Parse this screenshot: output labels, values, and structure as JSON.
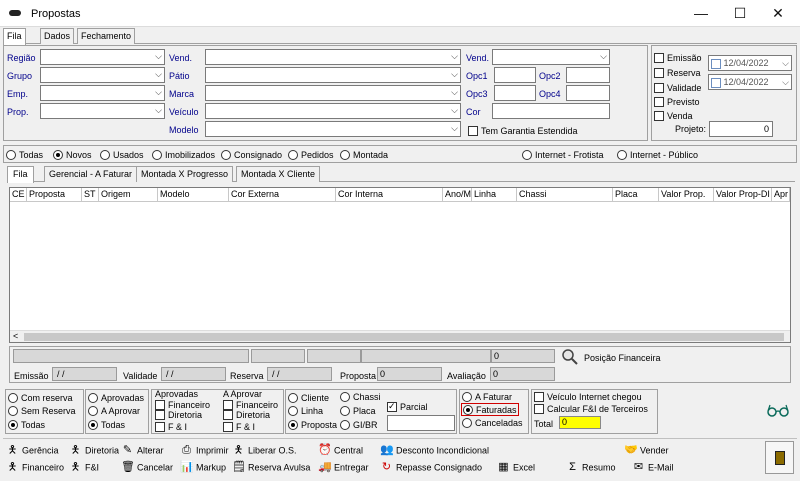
{
  "window": {
    "title": "Propostas",
    "minimize": "—",
    "maximize": "☐",
    "close": "✕"
  },
  "main_tabs": [
    "Fila",
    "Dados",
    "Fechamento"
  ],
  "filters": {
    "regiao": "Região",
    "grupo": "Grupo",
    "emp": "Emp.",
    "prop": "Prop.",
    "vend": "Vend.",
    "patio": "Pátio",
    "marca": "Marca",
    "veiculo": "Veículo",
    "modelo": "Modelo",
    "vend2": "Vend.",
    "opc1": "Opc1",
    "opc2": "Opc2",
    "opc3": "Opc3",
    "opc4": "Opc4",
    "cor": "Cor",
    "tem_garantia": "Tem Garantia Estendida"
  },
  "dates": {
    "emissao": "Emissão",
    "reserva": "Reserva",
    "validade": "Validade",
    "previsto": "Previsto",
    "venda": "Venda",
    "date1": "12/04/2022",
    "date2": "12/04/2022",
    "projeto_label": "Projeto:",
    "projeto_value": "0"
  },
  "radios1": [
    "Todas",
    "Novos",
    "Usados",
    "Imobilizados",
    "Consignado",
    "Pedidos",
    "Montada"
  ],
  "radios_internet": [
    "Internet - Frotista",
    "Internet - Público"
  ],
  "sub_tabs": [
    "Fila",
    "Gerencial - A Faturar",
    "Montada X Progresso",
    "Montada X Cliente"
  ],
  "columns": [
    "CE",
    "Proposta",
    "ST",
    "Origem",
    "Modelo",
    "Cor Externa",
    "Cor Interna",
    "Ano/M",
    "Linha",
    "Chassi",
    "Placa",
    "Valor Prop.",
    "Valor Prop-DI",
    "Apr"
  ],
  "scroll_left": "<",
  "summary": {
    "total_value": "0",
    "posicao": "Posição Financeira",
    "emissao": "Emissão",
    "emissao_val": " / /",
    "validade": "Validade",
    "validade_val": " / /",
    "reserva": "Reserva",
    "reserva_val": " / /",
    "proposta": "Proposta",
    "proposta_val": "0",
    "avaliacao": "Avaliação",
    "avaliacao_val": "0"
  },
  "bottom_opts": {
    "g1": [
      "Com reserva",
      "Sem Reserva",
      "Todas"
    ],
    "g2": [
      "Aprovadas",
      "A Aprovar",
      "Todas"
    ],
    "g3_head_a": "Aprovadas",
    "g3_head_b": "A Aprovar",
    "g3_checks": [
      "Financeiro",
      "Diretoria",
      "F & I"
    ],
    "g4": [
      "Cliente",
      "Linha",
      "Proposta"
    ],
    "g4b": [
      "Chassi",
      "Placa",
      "GI/BR"
    ],
    "parcial": "Parcial",
    "g5": [
      "A Faturar",
      "Faturadas",
      "Canceladas"
    ],
    "g6": [
      "Veículo Internet chegou",
      "Calcular F&I de Terceiros"
    ],
    "total_label": "Total",
    "total_value": "0"
  },
  "toolbar_row1": [
    "Gerência",
    "Diretoria",
    "Alterar",
    "Imprimir",
    "Liberar O.S.",
    "Central",
    "Desconto Incondicional",
    "Vender"
  ],
  "toolbar_row2": [
    "Financeiro",
    "F&I",
    "Cancelar",
    "Markup",
    "Reserva Avulsa",
    "Entregar",
    "Repasse Consignado",
    "Excel",
    "Resumo",
    "E-Mail"
  ],
  "colors": {
    "accent_label": "#00008b",
    "total_bg": "#ffff00",
    "highlight_red": "#d00000"
  }
}
